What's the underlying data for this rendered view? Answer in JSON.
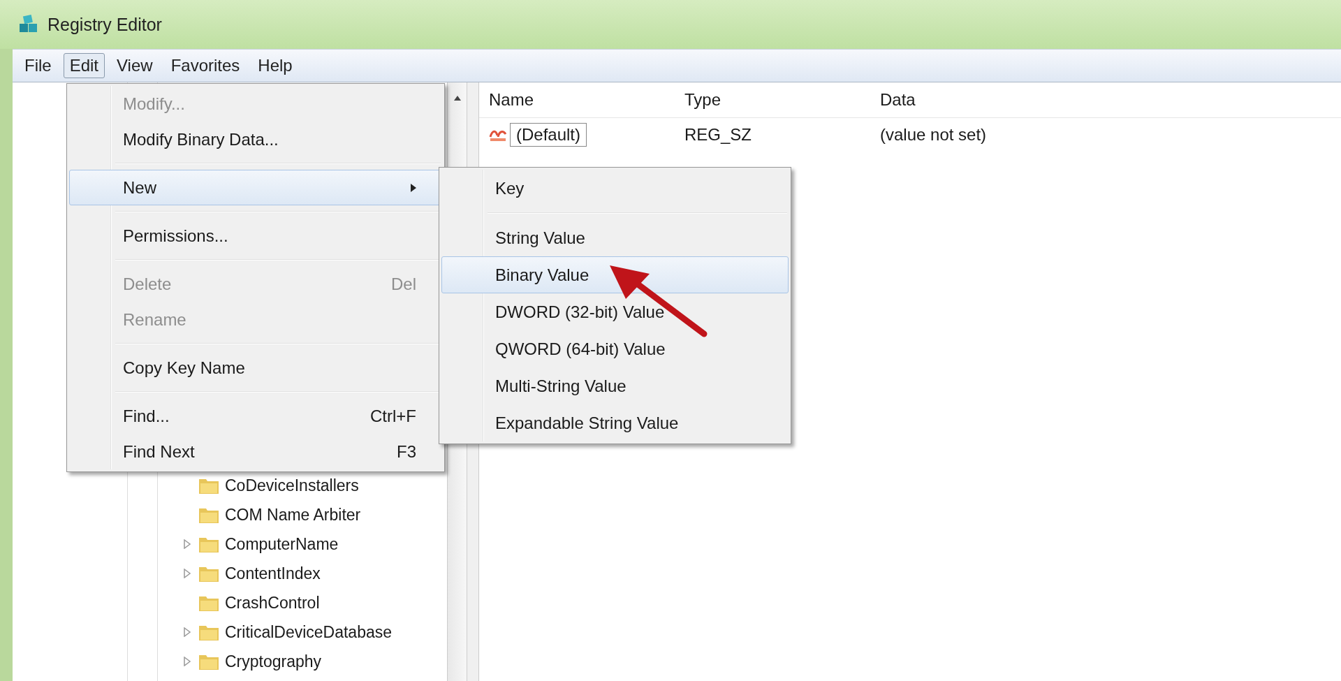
{
  "window": {
    "title": "Registry Editor"
  },
  "menu_bar": [
    {
      "label": "File",
      "selected": false
    },
    {
      "label": "Edit",
      "selected": true
    },
    {
      "label": "View",
      "selected": false
    },
    {
      "label": "Favorites",
      "selected": false
    },
    {
      "label": "Help",
      "selected": false
    }
  ],
  "edit_menu": {
    "items": [
      {
        "kind": "item",
        "label": "Modify...",
        "disabled": true,
        "selected": false,
        "has_submenu": false
      },
      {
        "kind": "item",
        "label": "Modify Binary Data...",
        "disabled": false,
        "selected": false,
        "has_submenu": false
      },
      {
        "kind": "separator"
      },
      {
        "kind": "item",
        "label": "New",
        "disabled": false,
        "selected": true,
        "has_submenu": true
      },
      {
        "kind": "separator"
      },
      {
        "kind": "item",
        "label": "Permissions...",
        "disabled": false,
        "selected": false,
        "has_submenu": false
      },
      {
        "kind": "separator"
      },
      {
        "kind": "item",
        "label": "Delete",
        "shortcut": "Del",
        "disabled": true,
        "selected": false,
        "has_submenu": false
      },
      {
        "kind": "item",
        "label": "Rename",
        "disabled": true,
        "selected": false,
        "has_submenu": false
      },
      {
        "kind": "separator"
      },
      {
        "kind": "item",
        "label": "Copy Key Name",
        "disabled": false,
        "selected": false,
        "has_submenu": false
      },
      {
        "kind": "separator"
      },
      {
        "kind": "item",
        "label": "Find...",
        "shortcut": "Ctrl+F",
        "disabled": false,
        "selected": false,
        "has_submenu": false
      },
      {
        "kind": "item",
        "label": "Find Next",
        "shortcut": "F3",
        "disabled": false,
        "selected": false,
        "has_submenu": false
      }
    ]
  },
  "new_submenu": {
    "items": [
      {
        "kind": "item",
        "label": "Key",
        "selected": false
      },
      {
        "kind": "separator"
      },
      {
        "kind": "item",
        "label": "String Value",
        "selected": false
      },
      {
        "kind": "item",
        "label": "Binary Value",
        "selected": true
      },
      {
        "kind": "item",
        "label": "DWORD (32-bit) Value",
        "selected": false
      },
      {
        "kind": "item",
        "label": "QWORD (64-bit) Value",
        "selected": false
      },
      {
        "kind": "item",
        "label": "Multi-String Value",
        "selected": false
      },
      {
        "kind": "item",
        "label": "Expandable String Value",
        "selected": false
      }
    ]
  },
  "tree": {
    "items": [
      {
        "kind": "leaf",
        "label": "CoDeviceInstallers"
      },
      {
        "kind": "leaf",
        "label": "COM Name Arbiter"
      },
      {
        "kind": "branch",
        "label": "ComputerName",
        "expanded": false
      },
      {
        "kind": "branch",
        "label": "ContentIndex",
        "expanded": false
      },
      {
        "kind": "leaf",
        "label": "CrashControl"
      },
      {
        "kind": "branch",
        "label": "CriticalDeviceDatabase",
        "expanded": false
      },
      {
        "kind": "branch",
        "label": "Cryptography",
        "expanded": false
      }
    ]
  },
  "values": {
    "columns": [
      "Name",
      "Type",
      "Data"
    ],
    "rows": [
      {
        "name": "(Default)",
        "type": "REG_SZ",
        "data": "(value not set)",
        "focused": true
      }
    ]
  }
}
